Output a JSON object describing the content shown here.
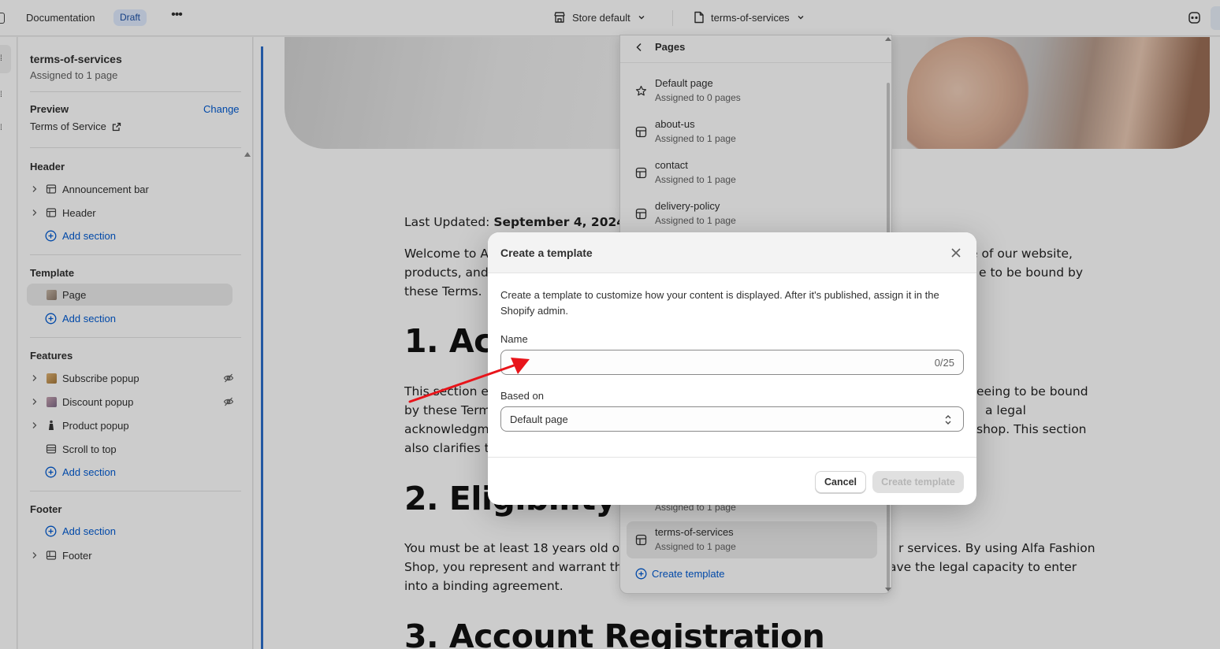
{
  "topbar": {
    "title": "Documentation",
    "badge": "Draft",
    "more": "•••",
    "store": "Store default",
    "template": "terms-of-services"
  },
  "sidebar": {
    "template_name": "terms-of-services",
    "assigned": "Assigned to 1 page",
    "preview_label": "Preview",
    "change_label": "Change",
    "preview_link": "Terms of Service",
    "header_group": "Header",
    "header_items": [
      "Announcement bar",
      "Header"
    ],
    "template_group": "Template",
    "template_items": [
      "Page"
    ],
    "features_group": "Features",
    "features_items": [
      "Subscribe popup",
      "Discount popup",
      "Product popup",
      "Scroll to top"
    ],
    "footer_group": "Footer",
    "footer_items": [
      "Footer"
    ],
    "add_section": "Add section"
  },
  "content": {
    "updated_prefix": "Last Updated: ",
    "updated_date": "September 4, 2024",
    "welcome_a": "Welcome to Al",
    "welcome_b": "e of our website,",
    "line2_a": "products, and",
    "line2_b": "e to be bound by",
    "line3": "these Terms.",
    "h1": "1. Acc",
    "s1_l1a": "This section e",
    "s1_l1b": "eeing to be bound",
    "s1_l2a": "by these Term",
    "s1_l2b": "a legal",
    "s1_l3a": "acknowledgm",
    "s1_l3b": "shop. This section",
    "s1_l4": "also clarifies th",
    "h2": "2. Eligibility",
    "s2_l1a": "You must be at least 18 years old or l",
    "s2_l1b": "r services. By using Alfa Fashion",
    "s2_l2a": "Shop, you represent and warrant tha",
    "s2_l2b": "ave the legal capacity to enter",
    "s2_l3": "into a binding agreement.",
    "h3": "3. Account Registration"
  },
  "popover": {
    "title": "Pages",
    "items": [
      {
        "name": "Default page",
        "sub": "Assigned to 0 pages",
        "icon": "star-icon"
      },
      {
        "name": "about-us",
        "sub": "Assigned to 1 page",
        "icon": "layout-icon"
      },
      {
        "name": "contact",
        "sub": "Assigned to 1 page",
        "icon": "layout-icon"
      },
      {
        "name": "delivery-policy",
        "sub": "Assigned to 1 page",
        "icon": "layout-icon"
      }
    ],
    "partial_sub": "Assigned to 1 page",
    "selected": {
      "name": "terms-of-services",
      "sub": "Assigned to 1 page"
    },
    "create": "Create template"
  },
  "modal": {
    "title": "Create a template",
    "description": "Create a template to customize how your content is displayed. After it's published, assign it in the Shopify admin.",
    "name_label": "Name",
    "name_value": "",
    "name_count": "0/25",
    "based_label": "Based on",
    "based_value": "Default page",
    "cancel": "Cancel",
    "create": "Create template"
  },
  "colors": {
    "accent": "#005bd3",
    "annotation": "#e8141a",
    "badge_bg": "#e0ecff"
  }
}
